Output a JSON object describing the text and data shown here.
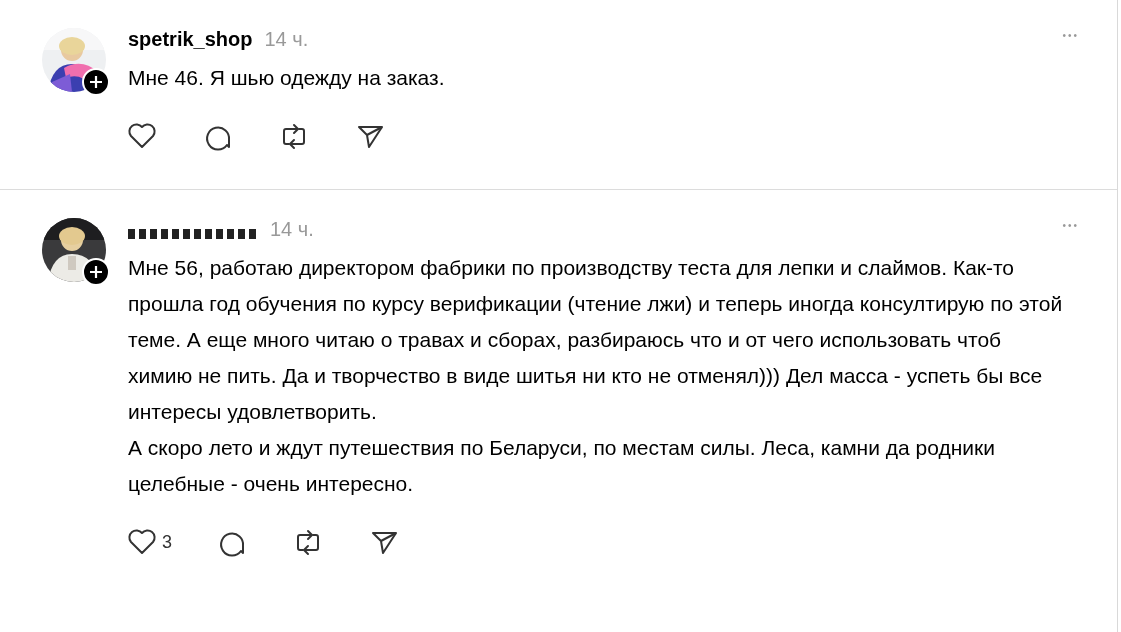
{
  "posts": [
    {
      "author": {
        "name": "spetrik_shop",
        "name_hidden": false
      },
      "time": "14 ч.",
      "more": "•••",
      "avatar": {
        "kind": "picture"
      },
      "paragraphs": [
        "Мне 46. Я шью одежду на заказ."
      ]
    },
    {
      "author": {
        "name_hidden": true
      },
      "time": "14 ч.",
      "more": "•••",
      "avatar": {
        "kind": "picture"
      },
      "paragraphs": [
        "Мне 56, работаю директором фабрики по производству теста для лепки и слаймов. Как-то прошла год обучения по курсу верификации (чтение лжи) и теперь иногда консултирую по этой теме. А еще много читаю о травах и сборах, разбираюсь что и от чего использовать чтоб химию не пить. Да и творчество в виде шитья ни кто не отменял))) Дел масса - успеть бы все интересы удовлетворить.",
        "А скоро лето и ждут путешествия по Беларуси, по местам силы. Леса, камни да родники целебные - очень интересно."
      ],
      "likes": "3"
    }
  ]
}
